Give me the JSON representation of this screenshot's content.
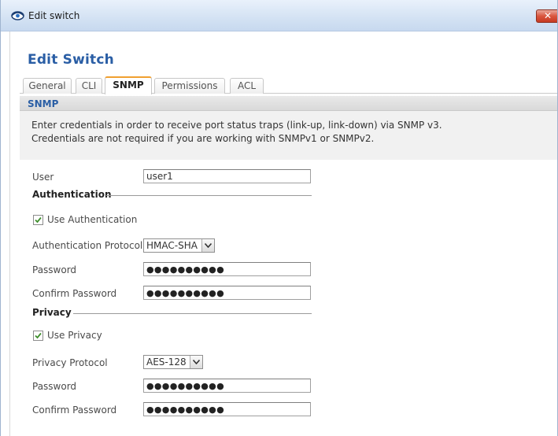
{
  "window": {
    "title": "Edit switch",
    "close_glyph": "✕",
    "icon": "eye-icon"
  },
  "dialog": {
    "title": "Edit Switch"
  },
  "tabs": [
    {
      "label": "General",
      "active": false
    },
    {
      "label": "CLI",
      "active": false
    },
    {
      "label": "SNMP",
      "active": true
    },
    {
      "label": "Permissions",
      "active": false
    },
    {
      "label": "ACL",
      "active": false
    }
  ],
  "section": {
    "title": "SNMP",
    "description_line1": "Enter credentials in order to receive port status traps (link-up, link-down) via SNMP v3.",
    "description_line2": "Credentials are not required if you are working with SNMPv1 or SNMPv2."
  },
  "form": {
    "user_label": "User",
    "user_value": "user1",
    "authentication": {
      "group_title": "Authentication",
      "use_label": "Use Authentication",
      "use_checked": true,
      "protocol_label": "Authentication Protocol",
      "protocol_value": "HMAC-SHA",
      "password_label": "Password",
      "password_mask": "●●●●●●●●●●",
      "confirm_label": "Confirm Password",
      "confirm_mask": "●●●●●●●●●●"
    },
    "privacy": {
      "group_title": "Privacy",
      "use_label": "Use Privacy",
      "use_checked": true,
      "protocol_label": "Privacy Protocol",
      "protocol_value": "AES-128",
      "password_label": "Password",
      "password_mask": "●●●●●●●●●●",
      "confirm_label": "Confirm Password",
      "confirm_mask": "●●●●●●●●●●"
    }
  },
  "colors": {
    "accent_blue": "#2a5ea5",
    "active_tab_border": "#f0a030",
    "close_button": "#d9553e",
    "checkmark": "#3f8f2d"
  }
}
